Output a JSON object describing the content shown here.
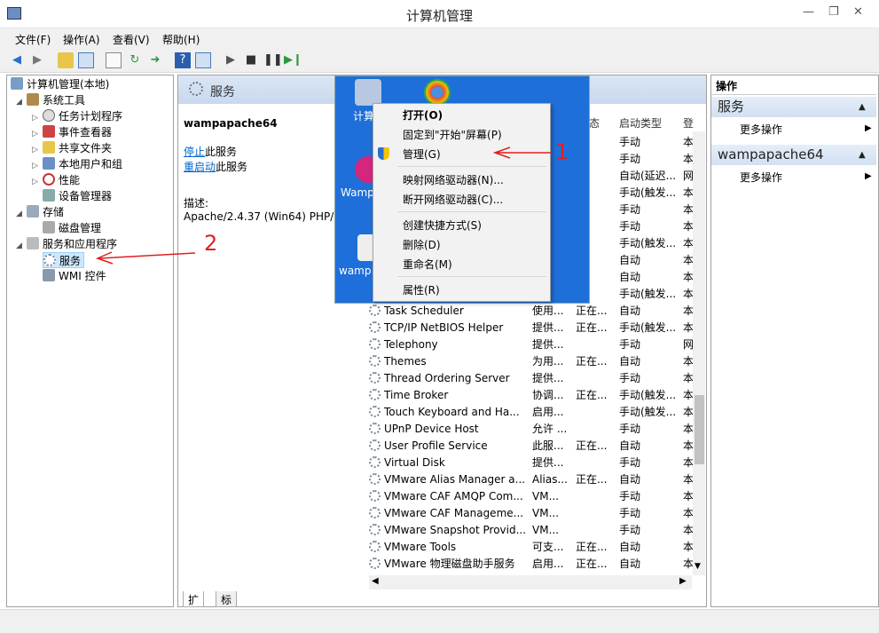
{
  "window": {
    "title": "计算机管理",
    "minimize": "—",
    "restore": "❐",
    "close": "✕"
  },
  "menubar": [
    "文件(F)",
    "操作(A)",
    "查看(V)",
    "帮助(H)"
  ],
  "tree": {
    "root": "计算机管理(本地)",
    "system_tools": "系统工具",
    "task_scheduler": "任务计划程序",
    "event_viewer": "事件查看器",
    "shared_folders": "共享文件夹",
    "local_users": "本地用户和组",
    "performance": "性能",
    "device_manager": "设备管理器",
    "storage": "存储",
    "disk_mgmt": "磁盘管理",
    "services_apps": "服务和应用程序",
    "services": "服务",
    "wmi": "WMI 控件"
  },
  "middle": {
    "header": "服务",
    "selected_service": "wampapache64",
    "stop_link": "停止",
    "stop_suffix": "此服务",
    "restart_link": "重启动",
    "restart_suffix": "此服务",
    "desc_label": "描述:",
    "desc_text": "Apache/2.4.37 (Win64) PHP/5",
    "columns": {
      "state": "态",
      "startup": "启动类型",
      "logon": "登"
    }
  },
  "services": [
    {
      "name": "",
      "desc": "",
      "state": "",
      "startup": "手动",
      "logon": "本"
    },
    {
      "name": "",
      "desc": "",
      "state": "",
      "startup": "手动",
      "logon": "本"
    },
    {
      "name": "",
      "desc": "",
      "state": "",
      "startup": "自动(延迟...",
      "logon": "网"
    },
    {
      "name": "",
      "desc": "",
      "state": "",
      "startup": "手动(触发...",
      "logon": "本"
    },
    {
      "name": "",
      "desc": "",
      "state": "",
      "startup": "手动",
      "logon": "本"
    },
    {
      "name": "",
      "desc": "",
      "state": "",
      "startup": "手动",
      "logon": "本"
    },
    {
      "name": "",
      "desc": "",
      "state": "",
      "startup": "手动(触发...",
      "logon": "本"
    },
    {
      "name": "",
      "desc": "",
      "state": "",
      "startup": "自动",
      "logon": "本"
    },
    {
      "name": "",
      "desc": "",
      "state": "",
      "startup": "自动",
      "logon": "本"
    },
    {
      "name": "",
      "desc": "",
      "state": "",
      "startup": "手动(触发...",
      "logon": "本"
    },
    {
      "name": "Task Scheduler",
      "desc": "使用...",
      "state": "正在...",
      "startup": "自动",
      "logon": "本"
    },
    {
      "name": "TCP/IP NetBIOS Helper",
      "desc": "提供...",
      "state": "正在...",
      "startup": "手动(触发...",
      "logon": "本"
    },
    {
      "name": "Telephony",
      "desc": "提供...",
      "state": "",
      "startup": "手动",
      "logon": "网"
    },
    {
      "name": "Themes",
      "desc": "为用...",
      "state": "正在...",
      "startup": "自动",
      "logon": "本"
    },
    {
      "name": "Thread Ordering Server",
      "desc": "提供...",
      "state": "",
      "startup": "手动",
      "logon": "本"
    },
    {
      "name": "Time Broker",
      "desc": "协调...",
      "state": "正在...",
      "startup": "手动(触发...",
      "logon": "本"
    },
    {
      "name": "Touch Keyboard and Ha...",
      "desc": "启用...",
      "state": "",
      "startup": "手动(触发...",
      "logon": "本"
    },
    {
      "name": "UPnP Device Host",
      "desc": "允许 ...",
      "state": "",
      "startup": "手动",
      "logon": "本"
    },
    {
      "name": "User Profile Service",
      "desc": "此服...",
      "state": "正在...",
      "startup": "自动",
      "logon": "本"
    },
    {
      "name": "Virtual Disk",
      "desc": "提供...",
      "state": "",
      "startup": "手动",
      "logon": "本"
    },
    {
      "name": "VMware Alias Manager a...",
      "desc": "Alias...",
      "state": "正在...",
      "startup": "自动",
      "logon": "本"
    },
    {
      "name": "VMware CAF AMQP Com...",
      "desc": "VM...",
      "state": "",
      "startup": "手动",
      "logon": "本"
    },
    {
      "name": "VMware CAF Manageme...",
      "desc": "VM...",
      "state": "",
      "startup": "手动",
      "logon": "本"
    },
    {
      "name": "VMware Snapshot Provid...",
      "desc": "VM...",
      "state": "",
      "startup": "手动",
      "logon": "本"
    },
    {
      "name": "VMware Tools",
      "desc": "可支...",
      "state": "正在...",
      "startup": "自动",
      "logon": "本"
    },
    {
      "name": "VMware 物理磁盘助手服务",
      "desc": "启用...",
      "state": "正在...",
      "startup": "自动",
      "logon": "本"
    }
  ],
  "tabs": [
    "扩展",
    "标准"
  ],
  "right": {
    "title": "操作",
    "section1": "服务",
    "section2": "wampapache64",
    "more": "更多操作",
    "arrow": "▶",
    "collapse": "▲"
  },
  "desktop": {
    "label1": "计算",
    "label2": "Wamp",
    "label3": "wamp"
  },
  "context_menu": {
    "open": "打开(O)",
    "pin": "固定到\"开始\"屏幕(P)",
    "manage": "管理(G)",
    "map_drive": "映射网络驱动器(N)...",
    "disconnect": "断开网络驱动器(C)...",
    "shortcut": "创建快捷方式(S)",
    "delete": "删除(D)",
    "rename": "重命名(M)",
    "properties": "属性(R)"
  },
  "annotations": {
    "one": "1",
    "two": "2"
  }
}
